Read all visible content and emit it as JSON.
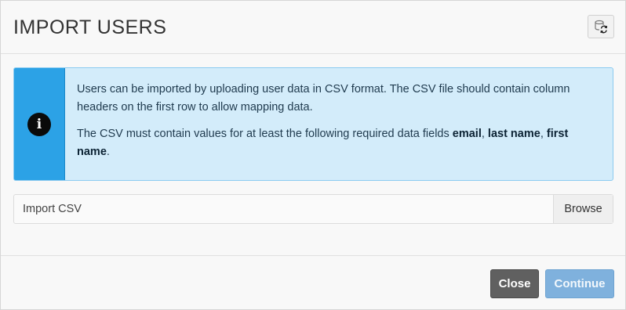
{
  "dialog": {
    "title": "IMPORT USERS",
    "refresh_icon": "database-refresh-icon"
  },
  "info": {
    "icon": "info-icon",
    "icon_glyph": "i",
    "paragraph1": "Users can be imported by uploading user data in CSV format. The CSV file should contain column headers on the first row to allow mapping data.",
    "paragraph2_prefix": "The CSV must contain values for at least the following required data fields ",
    "field_email": "email",
    "sep1": ", ",
    "field_last_name": "last name",
    "sep2": ", ",
    "field_first_name": "first name",
    "suffix": "."
  },
  "file_input": {
    "placeholder": "Import CSV",
    "browse_label": "Browse"
  },
  "footer": {
    "close_label": "Close",
    "continue_label": "Continue"
  },
  "colors": {
    "info_accent": "#2ca2e6",
    "info_background": "#d3ecfa",
    "close_button": "#606060",
    "continue_button": "#7fb1dd"
  }
}
